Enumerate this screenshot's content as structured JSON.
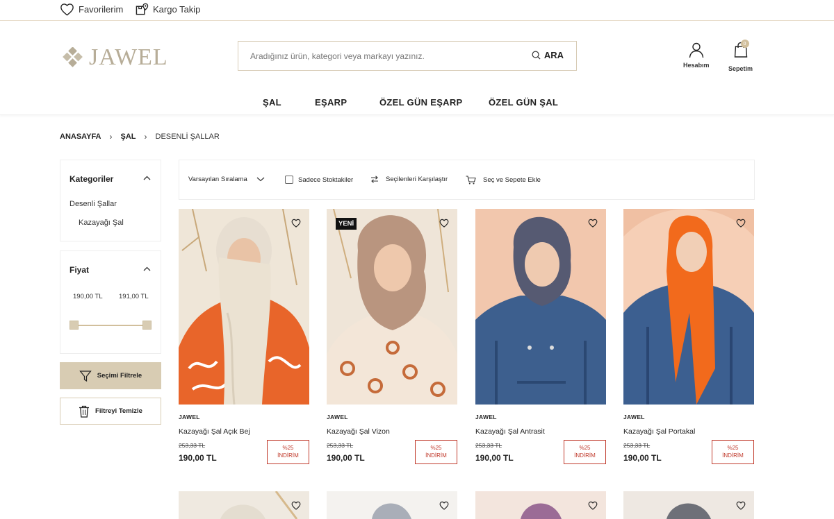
{
  "topbar": {
    "favorites_label": "Favorilerim",
    "tracking_label": "Kargo Takip"
  },
  "header": {
    "logo_text": "JAWEL",
    "search_placeholder": "Aradığınız ürün, kategori veya markayı yazınız.",
    "search_button": "ARA",
    "account_label": "Hesabım",
    "cart_label": "Sepetim",
    "cart_count": "0"
  },
  "nav": {
    "items": [
      "ŞAL",
      "EŞARP",
      "ÖZEL GÜN EŞARP",
      "ÖZEL GÜN ŞAL"
    ]
  },
  "breadcrumb": {
    "items": [
      "ANASAYFA",
      "ŞAL",
      "DESENLİ ŞALLAR"
    ]
  },
  "sidebar": {
    "categories_title": "Kategoriler",
    "categories": [
      "Desenli Şallar",
      "Kazayağı Şal"
    ],
    "price_title": "Fiyat",
    "price_min": "190,00 TL",
    "price_max": "191,00 TL",
    "filter_button": "Seçimi Filtrele",
    "clear_button": "Filtreyi Temizle"
  },
  "toolbar": {
    "sort_label": "Varsayılan Sıralama",
    "stock_label": "Sadece Stoktakiler",
    "compare_label": "Seçilenleri Karşılaştır",
    "add_cart_label": "Seç ve Sepete Ekle"
  },
  "products": [
    {
      "brand": "JAWEL",
      "name": "Kazayağı Şal Açık Bej",
      "old_price": "253,33 TL",
      "price": "190,00 TL",
      "discount_pct": "%25",
      "discount_label": "İNDİRİM",
      "badge": ""
    },
    {
      "brand": "JAWEL",
      "name": "Kazayağı Şal Vizon",
      "old_price": "253,33 TL",
      "price": "190,00 TL",
      "discount_pct": "%25",
      "discount_label": "İNDİRİM",
      "badge": "YENİ"
    },
    {
      "brand": "JAWEL",
      "name": "Kazayağı Şal Antrasit",
      "old_price": "253,33 TL",
      "price": "190,00 TL",
      "discount_pct": "%25",
      "discount_label": "İNDİRİM",
      "badge": ""
    },
    {
      "brand": "JAWEL",
      "name": "Kazayağı Şal Portakal",
      "old_price": "253,33 TL",
      "price": "190,00 TL",
      "discount_pct": "%25",
      "discount_label": "İNDİRİM",
      "badge": ""
    }
  ],
  "icons": {
    "heart": "heart-icon",
    "package": "package-pin-icon",
    "search": "search-icon",
    "user": "user-icon",
    "bag": "shopping-bag-icon",
    "chevron": "chevron-icon",
    "filter": "funnel-icon",
    "trash": "trash-icon",
    "compare": "compare-arrows-icon",
    "cart": "cart-icon"
  },
  "colors": {
    "accent": "#d8ccb3",
    "logo": "#b7ad98",
    "discount": "#c0392b"
  }
}
